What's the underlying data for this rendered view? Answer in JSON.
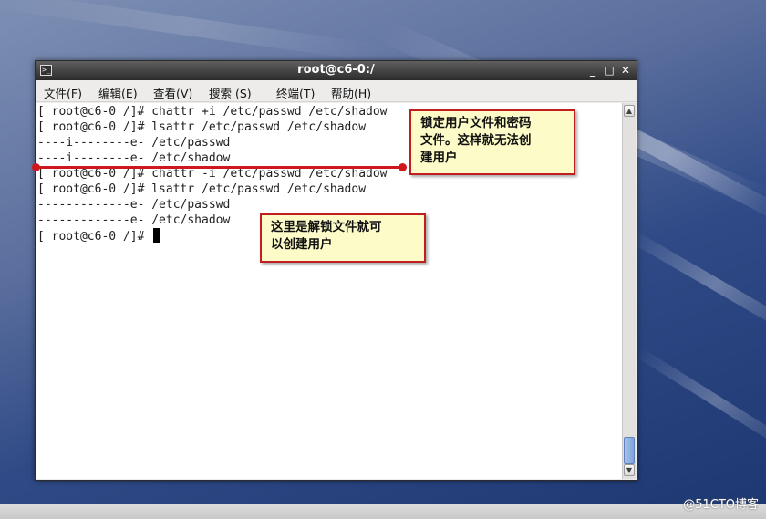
{
  "window": {
    "title": "root@c6-0:/",
    "controls": {
      "minimize": "_",
      "maximize": "□",
      "close": "✕"
    }
  },
  "menu": {
    "items": [
      "文件(F)",
      "编辑(E)",
      "查看(V)",
      "搜索 (S)",
      "终端(T)",
      "帮助(H)"
    ]
  },
  "terminal": {
    "lines": [
      "[ root@c6-0 /]# chattr +i /etc/passwd /etc/shadow",
      "[ root@c6-0 /]# lsattr /etc/passwd /etc/shadow",
      "----i--------e- /etc/passwd",
      "----i--------e- /etc/shadow",
      "[ root@c6-0 /]# chattr -i /etc/passwd /etc/shadow",
      "[ root@c6-0 /]# lsattr /etc/passwd /etc/shadow",
      "-------------e- /etc/passwd",
      "-------------e- /etc/shadow",
      "[ root@c6-0 /]# "
    ]
  },
  "annotations": {
    "lock_note": [
      "锁定用户文件和密码",
      "文件。这样就无法创",
      "建用户"
    ],
    "unlock_note": [
      "这里是解锁文件就可",
      "以创建用户"
    ]
  },
  "watermark": "@51CTO博客",
  "colors": {
    "annotation_border": "#c11f1f",
    "annotation_bg": "#fdfbc7",
    "marker_line": "#d0171b"
  }
}
